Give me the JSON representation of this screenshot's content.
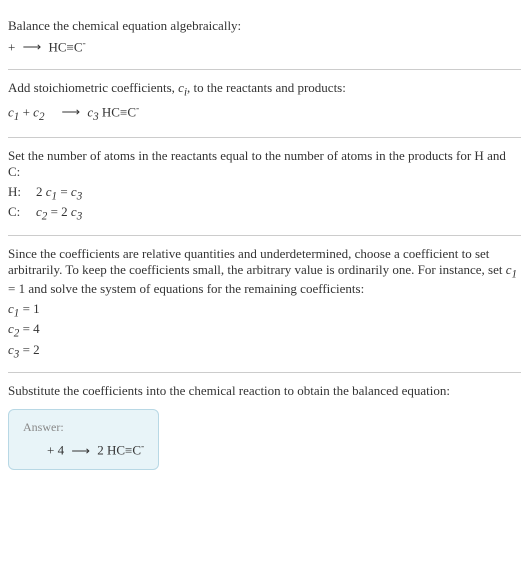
{
  "section1": {
    "intro": "Balance the chemical equation algebraically:",
    "eq_left": " + ",
    "arrow": "⟶",
    "eq_right_prefix": " HC≡C",
    "eq_right_sup": "-"
  },
  "section2": {
    "intro_prefix": "Add stoichiometric coefficients, ",
    "ci_c": "c",
    "ci_i": "i",
    "intro_suffix": ", to the reactants and products:",
    "c1": "c",
    "c1_sub": "1",
    "plus": " + ",
    "c2": "c",
    "c2_sub": "2",
    "arrow": "⟶",
    "c3": "c",
    "c3_sub": "3",
    "prod": " HC≡C",
    "prod_sup": "-"
  },
  "section3": {
    "intro": "Set the number of atoms in the reactants equal to the number of atoms in the products for H and C:",
    "h_label": "H:",
    "h_eq_2": "2 ",
    "h_eq_c1": "c",
    "h_eq_c1_sub": "1",
    "h_eq_eq": " = ",
    "h_eq_c3": "c",
    "h_eq_c3_sub": "3",
    "c_label": "C:",
    "c_eq_c2": "c",
    "c_eq_c2_sub": "2",
    "c_eq_eq": " = 2 ",
    "c_eq_c3": "c",
    "c_eq_c3_sub": "3"
  },
  "section4": {
    "intro_a": "Since the coefficients are relative quantities and underdetermined, choose a coefficient to set arbitrarily. To keep the coefficients small, the arbitrary value is ordinarily one. For instance, set ",
    "c1": "c",
    "c1_sub": "1",
    "intro_b": " = 1 and solve the system of equations for the remaining coefficients:",
    "l1_c": "c",
    "l1_sub": "1",
    "l1_val": " = 1",
    "l2_c": "c",
    "l2_sub": "2",
    "l2_val": " = 4",
    "l3_c": "c",
    "l3_sub": "3",
    "l3_val": " = 2"
  },
  "section5": {
    "intro": "Substitute the coefficients into the chemical reaction to obtain the balanced equation:",
    "answer_label": "Answer:",
    "eq_left": " + 4 ",
    "arrow": "⟶",
    "eq_mid": " 2 HC≡C",
    "eq_sup": "-"
  }
}
